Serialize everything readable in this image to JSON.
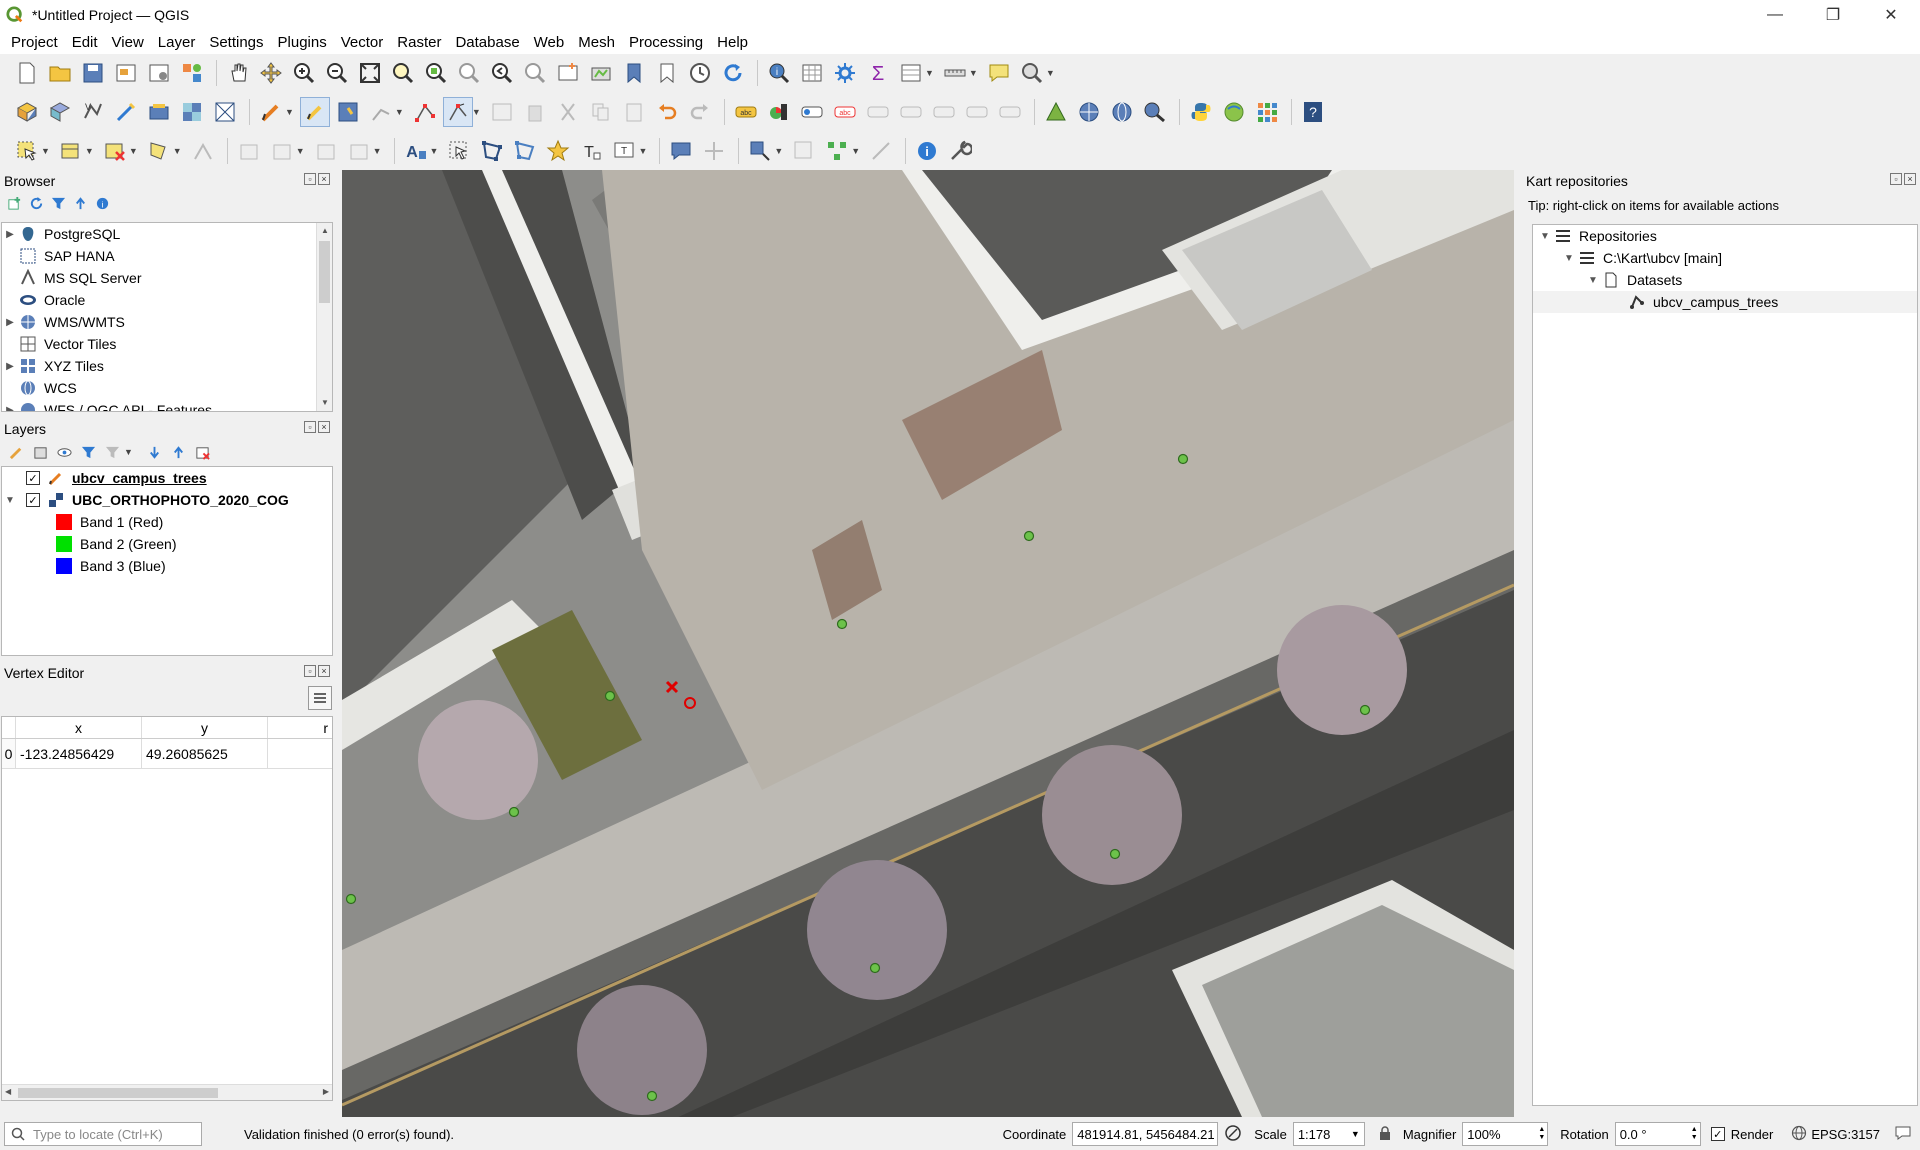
{
  "window": {
    "title": "*Untitled Project — QGIS",
    "minimize": "—",
    "restore": "❐",
    "close": "✕"
  },
  "menubar": [
    "Project",
    "Edit",
    "View",
    "Layer",
    "Settings",
    "Plugins",
    "Vector",
    "Raster",
    "Database",
    "Web",
    "Mesh",
    "Processing",
    "Help"
  ],
  "browser": {
    "title": "Browser",
    "items": [
      {
        "label": "PostgreSQL",
        "icon": "postgresql-icon",
        "expandable": true
      },
      {
        "label": "SAP HANA",
        "icon": "sap-hana-icon",
        "expandable": false
      },
      {
        "label": "MS SQL Server",
        "icon": "mssql-icon",
        "expandable": false
      },
      {
        "label": "Oracle",
        "icon": "oracle-icon",
        "expandable": false
      },
      {
        "label": "WMS/WMTS",
        "icon": "wms-icon",
        "expandable": true
      },
      {
        "label": "Vector Tiles",
        "icon": "vector-tiles-icon",
        "expandable": false
      },
      {
        "label": "XYZ Tiles",
        "icon": "xyz-tiles-icon",
        "expandable": true
      },
      {
        "label": "WCS",
        "icon": "wcs-icon",
        "expandable": false
      },
      {
        "label": "WFS / OGC API - Features",
        "icon": "wfs-icon",
        "expandable": true
      }
    ]
  },
  "layers": {
    "title": "Layers",
    "items": [
      {
        "label": "ubcv_campus_trees",
        "checked": true
      },
      {
        "label": "UBC_ORTHOPHOTO_2020_COG",
        "checked": true
      }
    ],
    "bands": [
      {
        "label": "Band 1 (Red)",
        "color": "#ff0000"
      },
      {
        "label": "Band 2 (Green)",
        "color": "#00e000"
      },
      {
        "label": "Band 3 (Blue)",
        "color": "#0000ff"
      }
    ]
  },
  "vertex_editor": {
    "title": "Vertex Editor",
    "columns": [
      "x",
      "y",
      "r"
    ],
    "rows": [
      {
        "index": "0",
        "x": "-123.24856429",
        "y": "49.26085625",
        "r": ""
      }
    ]
  },
  "kart": {
    "title": "Kart repositories",
    "hint": "Tip: right-click on items for available actions",
    "root": "Repositories",
    "repo": "C:\\Kart\\ubcv [main]",
    "datasets": "Datasets",
    "dataset": "ubcv_campus_trees"
  },
  "status": {
    "locator_placeholder": "Type to locate (Ctrl+K)",
    "message": "Validation finished (0 error(s) found).",
    "coordinate_label": "Coordinate",
    "coordinate": "481914.81, 5456484.21",
    "scale_label": "Scale",
    "scale": "1:178",
    "magnifier_label": "Magnifier",
    "magnifier": "100%",
    "rotation_label": "Rotation",
    "rotation": "0.0 °",
    "render_label": "Render",
    "crs": "EPSG:3157"
  },
  "colors": {
    "accent": "#589632",
    "point_green": "#4caf50",
    "selection_red": "#e00000"
  }
}
